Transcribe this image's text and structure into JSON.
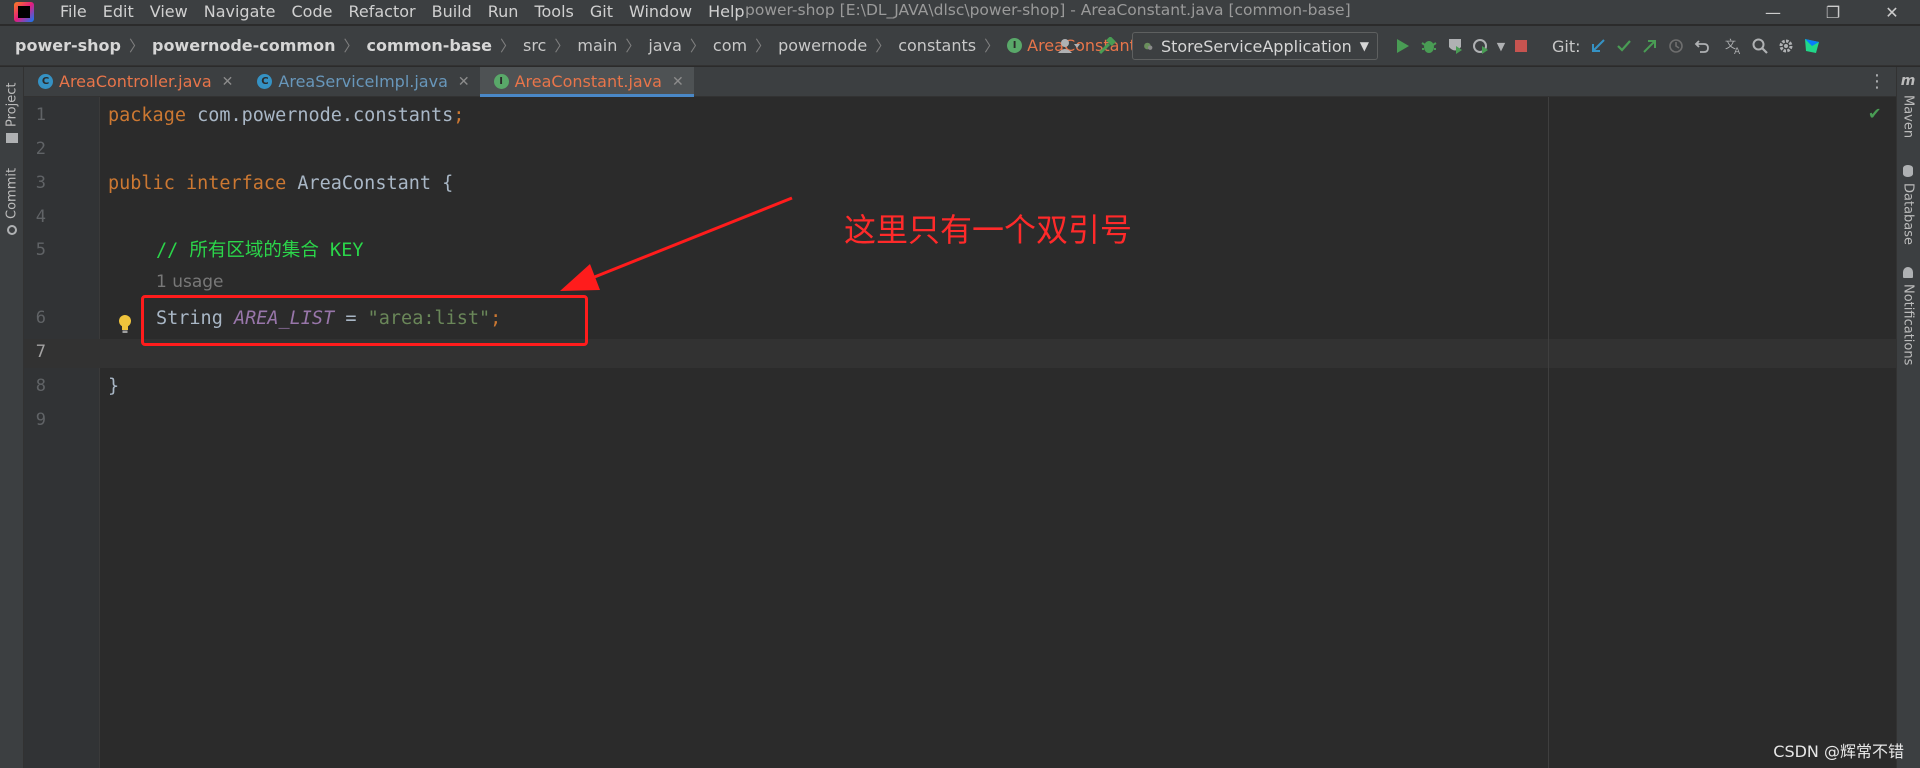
{
  "window": {
    "title": "power-shop [E:\\DL_JAVA\\dlsc\\power-shop] - AreaConstant.java [common-base]",
    "minimize": "—",
    "maximize": "❐",
    "close": "✕"
  },
  "menu": [
    {
      "label": "File"
    },
    {
      "label": "Edit"
    },
    {
      "label": "View"
    },
    {
      "label": "Navigate"
    },
    {
      "label": "Code"
    },
    {
      "label": "Refactor"
    },
    {
      "label": "Build"
    },
    {
      "label": "Run"
    },
    {
      "label": "Tools"
    },
    {
      "label": "Git"
    },
    {
      "label": "Window"
    },
    {
      "label": "Help"
    }
  ],
  "breadcrumb": {
    "items": [
      "power-shop",
      "powernode-common",
      "common-base",
      "src",
      "main",
      "java",
      "com",
      "powernode",
      "constants"
    ],
    "current": "AreaConstant",
    "current_icon_letter": "I"
  },
  "toolbar": {
    "run_config": "StoreServiceApplication",
    "git_label": "Git:"
  },
  "tabs": [
    {
      "label": "AreaController.java",
      "icon_letter": "C",
      "icon_color": "#3592c4",
      "text_color": "#e8754a",
      "active": false
    },
    {
      "label": "AreaServiceImpl.java",
      "icon_letter": "C",
      "icon_color": "#3592c4",
      "text_color": "#6897bb",
      "active": false
    },
    {
      "label": "AreaConstant.java",
      "icon_letter": "I",
      "icon_color": "#59a869",
      "text_color": "#e8754a",
      "active": true
    }
  ],
  "side_tools": {
    "project": "Project",
    "commit": "Commit",
    "maven": "Maven",
    "database": "Database",
    "notifications": "Notifications",
    "maven_icon": "m"
  },
  "code": {
    "line_numbers": [
      "1",
      "2",
      "3",
      "4",
      "5",
      "6",
      "7",
      "8",
      "9"
    ],
    "line1": {
      "kw": "package",
      "rest": " com.powernode.constants",
      "semi": ";"
    },
    "line3": {
      "kw1": "public",
      "kw2": "interface",
      "rest": " AreaConstant {"
    },
    "line5": {
      "comment": "// 所有区域的集合 KEY"
    },
    "usage_hint": "1 usage",
    "line6": {
      "type": "String ",
      "const": "AREA_LIST",
      "eq": " = ",
      "str": "\"area:list\"",
      "semi": ";"
    },
    "line8": {
      "brace": "}"
    }
  },
  "annotation": {
    "text": "这里只有一个双引号",
    "color": "#ff2a2a"
  },
  "watermark": "CSDN @辉常不错",
  "colors": {
    "keyword": "#cc7832",
    "comment": "#2bd64a",
    "constant": "#9876aa",
    "string": "#6a8759",
    "accent": "#4a88c7"
  }
}
